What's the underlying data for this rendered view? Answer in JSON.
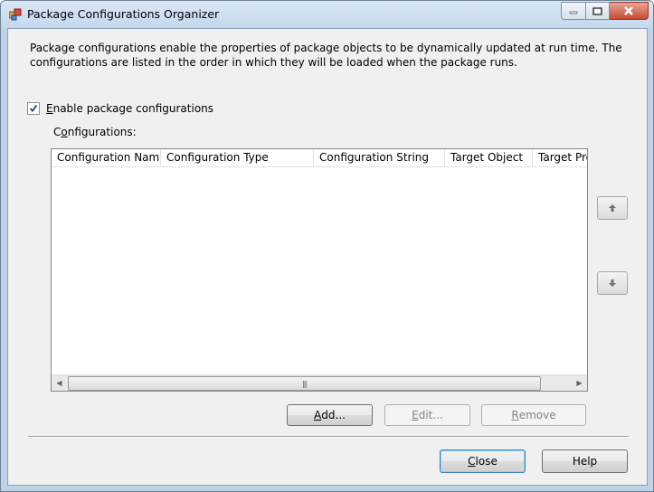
{
  "window": {
    "title": "Package Configurations Organizer",
    "icon": "package-app-icon"
  },
  "description": "Package configurations enable the properties of package objects to be dynamically updated at run time. The configurations are listed in the order in which they will be loaded when the package runs.",
  "enable_checkbox": {
    "label_first": "E",
    "label_rest": "nable package configurations",
    "checked": true
  },
  "configurations": {
    "label_pre": "C",
    "label_under": "o",
    "label_post": "nfigurations:",
    "columns": [
      "Configuration Name",
      "Configuration Type",
      "Configuration String",
      "Target Object",
      "Target Pro"
    ],
    "rows": []
  },
  "move_buttons": {
    "up_icon": "arrow-up-icon",
    "down_icon": "arrow-down-icon"
  },
  "buttons": {
    "add_under": "A",
    "add_rest": "dd...",
    "edit_under": "E",
    "edit_rest": "dit...",
    "remove_under": "R",
    "remove_rest": "emove",
    "close_under": "C",
    "close_rest": "lose",
    "help": "Help"
  },
  "colors": {
    "title_bar": "#c3d7ec",
    "client": "#f0f0f0",
    "close_caption": "#c84b33"
  }
}
